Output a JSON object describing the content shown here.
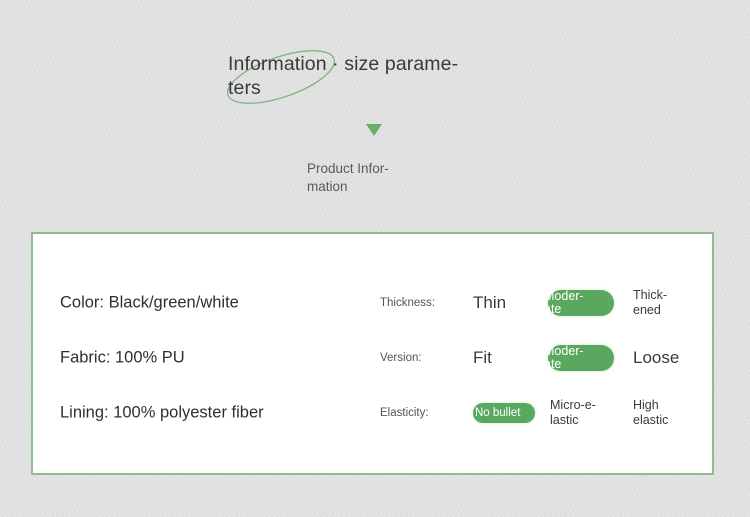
{
  "page": {
    "background_color": "#dcdcdc",
    "accent_color": "#5aa85f",
    "card_border_color": "#8cbf8c"
  },
  "header": {
    "title": "Information · size parame-\nters",
    "arrow_icon": "triangle-down-icon",
    "subtitle": "Product Infor-\nmation"
  },
  "card": {
    "rows": [
      {
        "left_text": "Color: Black/green/white",
        "label": "Thickness:",
        "options": [
          {
            "text": "Thin",
            "selected": false,
            "size": "big"
          },
          {
            "text": "Moder-\nate",
            "selected": true,
            "size": "big"
          },
          {
            "text": "Thick-\nened",
            "selected": false,
            "size": "small"
          }
        ]
      },
      {
        "left_text": "Fabric: 100% PU",
        "label": "Version:",
        "options": [
          {
            "text": "Fit",
            "selected": false,
            "size": "big"
          },
          {
            "text": "Moder-\nate",
            "selected": true,
            "size": "big"
          },
          {
            "text": "Loose",
            "selected": false,
            "size": "big"
          }
        ]
      },
      {
        "left_text": "Lining: 100% polyester fiber",
        "label": "Elasticity:",
        "options": [
          {
            "text": "No bullet",
            "selected": true,
            "size": "small"
          },
          {
            "text": "Micro-e-\nlastic",
            "selected": false,
            "size": "small"
          },
          {
            "text": "High\nelastic",
            "selected": false,
            "size": "small"
          }
        ]
      }
    ]
  }
}
